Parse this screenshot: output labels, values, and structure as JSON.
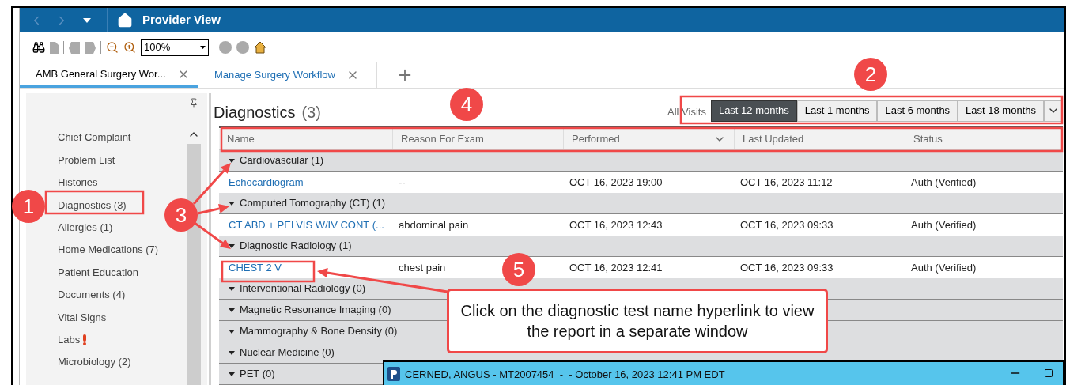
{
  "window": {
    "title": "Provider View"
  },
  "toolbar": {
    "zoom": "100%"
  },
  "tabs": [
    {
      "label": "AMB General Surgery Wor...",
      "selected": true
    },
    {
      "label": "Manage Surgery Workflow",
      "selected": false
    }
  ],
  "sidebar": {
    "items": [
      {
        "label": "Chief Complaint",
        "alert": false
      },
      {
        "label": "Problem List",
        "alert": false
      },
      {
        "label": "Histories",
        "alert": false
      },
      {
        "label": "Diagnostics (3)",
        "alert": false
      },
      {
        "label": "Allergies (1)",
        "alert": false
      },
      {
        "label": "Home Medications (7)",
        "alert": false
      },
      {
        "label": "Patient Education",
        "alert": false
      },
      {
        "label": "Documents (4)",
        "alert": false
      },
      {
        "label": "Vital Signs",
        "alert": false
      },
      {
        "label": "Labs",
        "alert": true
      },
      {
        "label": "Microbiology (2)",
        "alert": false
      }
    ]
  },
  "section": {
    "title": "Diagnostics",
    "count": "(3)",
    "filter_label": "All Visits",
    "filters": [
      {
        "label": "Last 12 months",
        "selected": true
      },
      {
        "label": "Last 1 months",
        "selected": false
      },
      {
        "label": "Last 6 months",
        "selected": false
      },
      {
        "label": "Last 18 months",
        "selected": false
      }
    ]
  },
  "table": {
    "columns": [
      {
        "label": "Name",
        "sorted": false
      },
      {
        "label": "Reason For Exam",
        "sorted": false
      },
      {
        "label": "Performed",
        "sorted": true
      },
      {
        "label": "Last Updated",
        "sorted": false
      },
      {
        "label": "Status",
        "sorted": false
      }
    ],
    "groups": [
      {
        "label": "Cardiovascular (1)",
        "expanded": true,
        "rows": [
          [
            "Echocardiogram",
            "--",
            "OCT 16, 2023 19:00",
            "OCT 16, 2023 11:12",
            "Auth (Verified)"
          ]
        ]
      },
      {
        "label": "Computed Tomography (CT) (1)",
        "expanded": true,
        "rows": [
          [
            "CT ABD + PELVIS W/IV CONT (...",
            "abdominal pain",
            "OCT 16, 2023 12:43",
            "OCT 16, 2023 09:33",
            "Auth (Verified)"
          ]
        ]
      },
      {
        "label": "Diagnostic Radiology (1)",
        "expanded": true,
        "rows": [
          [
            "CHEST 2 V",
            "chest pain",
            "OCT 16, 2023 12:41",
            "OCT 16, 2023 09:33",
            "Auth (Verified)"
          ]
        ]
      },
      {
        "label": "Interventional Radiology (0)",
        "expanded": true
      },
      {
        "label": "Magnetic Resonance Imaging (0)",
        "expanded": true
      },
      {
        "label": "Mammography & Bone Density (0)",
        "expanded": true
      },
      {
        "label": "Nuclear Medicine (0)",
        "expanded": true
      },
      {
        "label": "PET (0)",
        "expanded": true
      }
    ]
  },
  "popup": {
    "title": "CERNED, ANGUS - MT2007454  -  - October 16, 2023 12:41 PM EDT"
  },
  "annotations": {
    "markers": [
      "1",
      "2",
      "3",
      "4",
      "5"
    ],
    "callout": "Click on the diagnostic test name hyperlink to view the report in a separate window"
  }
}
